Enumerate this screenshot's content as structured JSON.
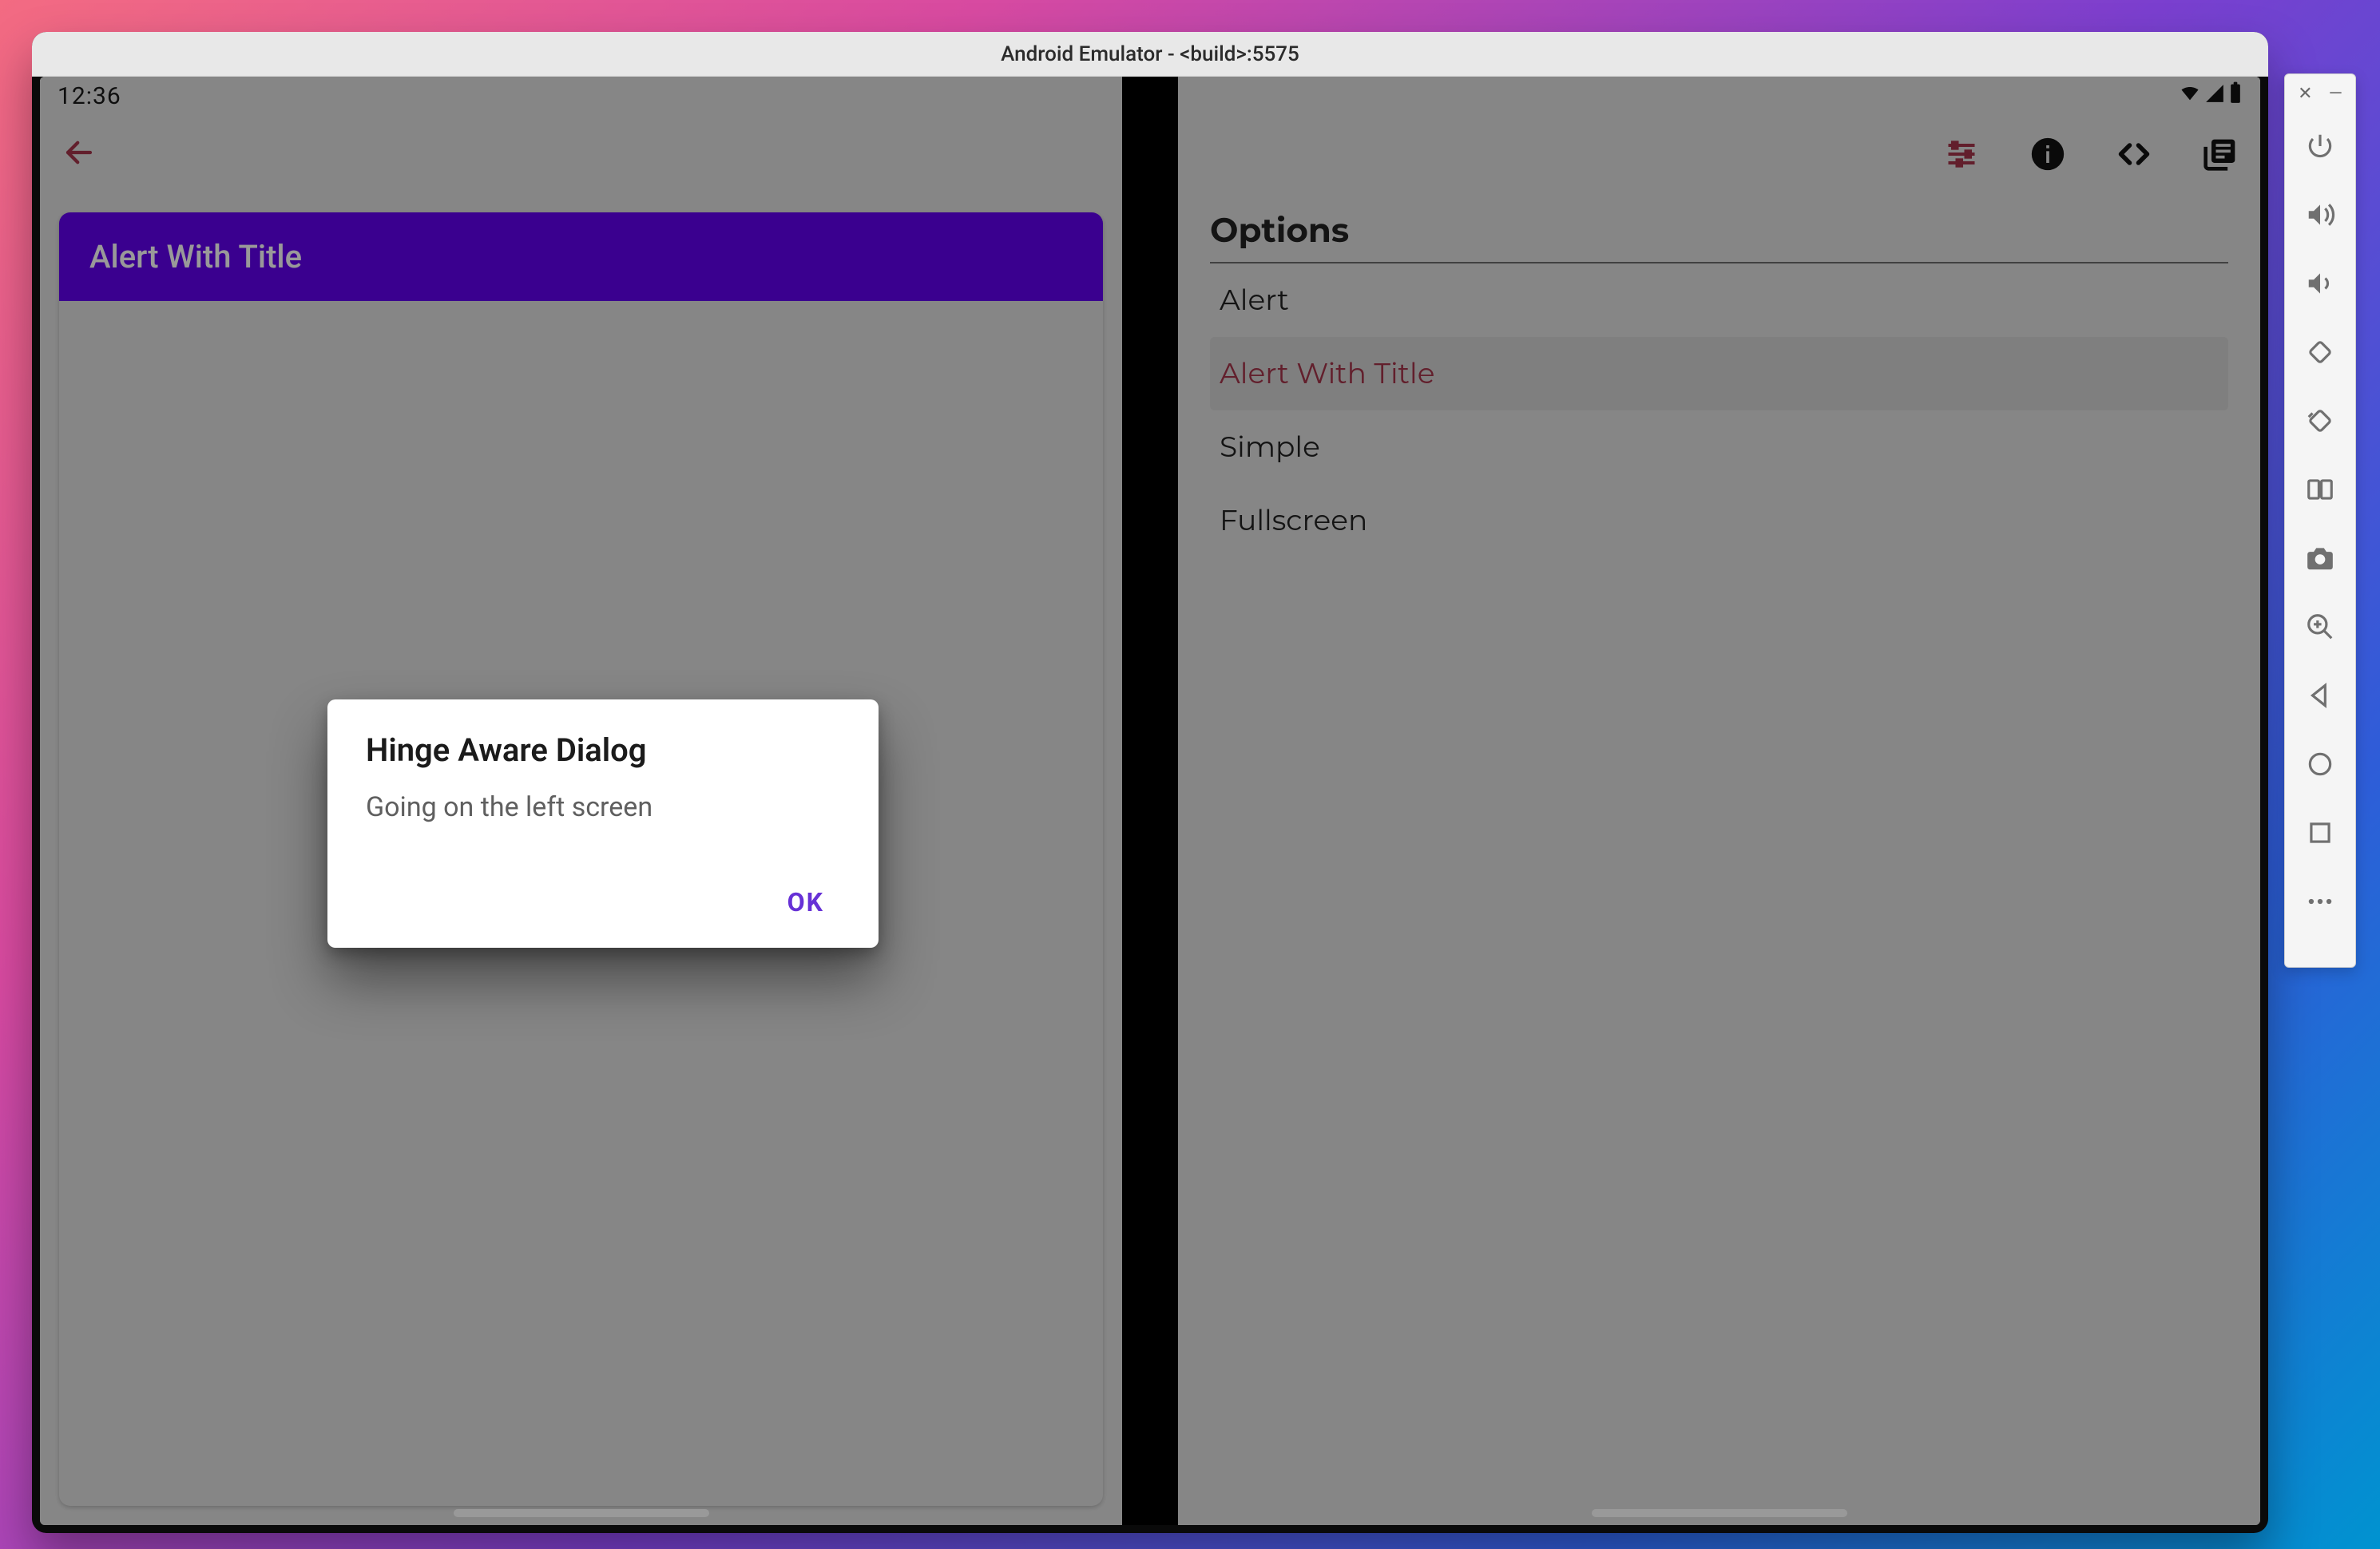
{
  "emulator": {
    "window_title": "Android Emulator - <build>:5575",
    "sidebar_items": [
      "power",
      "volume-up",
      "volume-down",
      "rotate-left",
      "rotate-right",
      "fold",
      "camera",
      "zoom",
      "back",
      "overview",
      "home",
      "more"
    ]
  },
  "statusbar": {
    "time": "12:36"
  },
  "left_pane": {
    "header_title": "Alert With Title"
  },
  "right_pane": {
    "section_title": "Options",
    "items": [
      {
        "label": "Alert",
        "selected": false
      },
      {
        "label": "Alert With Title",
        "selected": true
      },
      {
        "label": "Simple",
        "selected": false
      },
      {
        "label": "Fullscreen",
        "selected": false
      }
    ]
  },
  "dialog": {
    "title": "Hinge Aware Dialog",
    "body": "Going on the left screen",
    "ok_label": "OK"
  },
  "colors": {
    "primary": "#6200ee",
    "accent": "#a4344a"
  }
}
